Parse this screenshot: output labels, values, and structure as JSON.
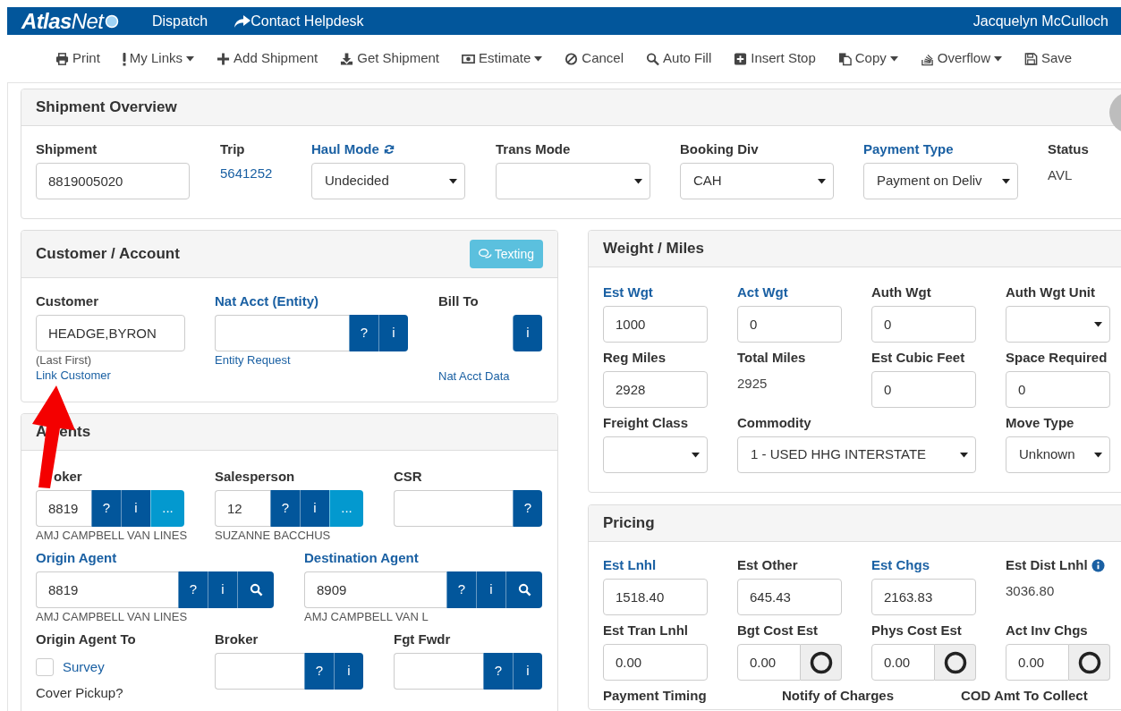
{
  "header": {
    "logo": [
      "Atlas",
      "Net"
    ],
    "nav": [
      {
        "label": "Dispatch"
      },
      {
        "label": "Contact Helpdesk"
      }
    ],
    "user": "Jacquelyn McCulloch"
  },
  "toolbar": [
    {
      "label": "Print",
      "dropdown": false
    },
    {
      "label": "My Links",
      "dropdown": true
    },
    {
      "label": "Add Shipment",
      "dropdown": false
    },
    {
      "label": "Get Shipment",
      "dropdown": false
    },
    {
      "label": "Estimate",
      "dropdown": true
    },
    {
      "label": "Cancel",
      "dropdown": false
    },
    {
      "label": "Auto Fill",
      "dropdown": false
    },
    {
      "label": "Insert Stop",
      "dropdown": false
    },
    {
      "label": "Copy",
      "dropdown": true
    },
    {
      "label": "Overflow",
      "dropdown": true
    },
    {
      "label": "Save",
      "dropdown": false
    }
  ],
  "panels": [
    {
      "title": "Shipment Overview",
      "rows": [
        [
          {
            "label": "Shipment",
            "label_link": false,
            "kind": "input",
            "value": "8819005020"
          },
          {
            "label": "Trip",
            "label_link": false,
            "kind": "link",
            "value": "5641252"
          },
          {
            "label": "Haul Mode",
            "label_link": true,
            "refresh": true,
            "kind": "select",
            "value": "Undecided"
          },
          {
            "label": "Trans Mode",
            "label_link": false,
            "kind": "select"
          },
          {
            "label": "Booking Div",
            "label_link": false,
            "kind": "select",
            "value": "CAH"
          },
          {
            "label": "Payment Type",
            "label_link": true,
            "kind": "select",
            "value": "Payment on Deliv"
          },
          {
            "label": "Status",
            "label_link": false,
            "kind": "text",
            "value": "AVL"
          }
        ]
      ]
    },
    {
      "title": "Customer / Account",
      "header_button": "Texting",
      "rows": [
        [
          {
            "label": "Customer",
            "label_link": false,
            "kind": "input",
            "value": "HEADGE,BYRON",
            "notes": [
              {
                "text": "(Last First)",
                "link": false
              },
              {
                "text": "Link Customer",
                "link": true
              }
            ]
          },
          {
            "label": "Nat Acct (Entity)",
            "label_link": true,
            "kind": "group",
            "buttons": [
              {
                "kind": "dark",
                "label": "?"
              },
              {
                "kind": "dark",
                "label": "i"
              }
            ],
            "notes": [
              {
                "text": "Entity Request",
                "link": true
              }
            ]
          },
          {
            "label": "Bill To",
            "label_link": false,
            "kind": "buttons",
            "buttons": [
              {
                "kind": "dark",
                "label": "i"
              }
            ],
            "notes": [
              {
                "text": "Nat Acct Data",
                "link": true
              }
            ]
          }
        ]
      ]
    },
    {
      "title_parts": [
        "A",
        "ents"
      ],
      "rows": [
        [
          {
            "label": "oker",
            "label_link": false,
            "kind": "group",
            "value": "8819",
            "buttons": [
              {
                "kind": "dark",
                "label": "?"
              },
              {
                "kind": "dark",
                "label": "i"
              },
              {
                "kind": "light",
                "label": "..."
              }
            ],
            "notes": [
              {
                "text": "AMJ CAMPBELL VAN LINES",
                "link": false
              }
            ]
          },
          {
            "label": "Salesperson",
            "label_link": false,
            "kind": "group",
            "value": "12",
            "buttons": [
              {
                "kind": "dark",
                "label": "?"
              },
              {
                "kind": "dark",
                "label": "i"
              },
              {
                "kind": "light",
                "label": "..."
              }
            ],
            "notes": [
              {
                "text": "SUZANNE BACCHUS",
                "link": false
              }
            ]
          },
          {
            "label": "CSR",
            "label_link": false,
            "kind": "group",
            "buttons": [
              {
                "kind": "dark",
                "label": "?"
              }
            ]
          }
        ],
        [
          {
            "label": "Origin Agent",
            "label_link": true,
            "kind": "group",
            "value": "8819",
            "buttons": [
              {
                "kind": "dark",
                "label": "?"
              },
              {
                "kind": "dark",
                "label": "i"
              },
              {
                "kind": "search"
              }
            ],
            "notes": [
              {
                "text": "AMJ CAMPBELL VAN LINES",
                "link": false
              }
            ]
          },
          {
            "label": "Destination Agent",
            "label_link": true,
            "kind": "group",
            "value": "8909",
            "buttons": [
              {
                "kind": "dark",
                "label": "?"
              },
              {
                "kind": "dark",
                "label": "i"
              },
              {
                "kind": "search"
              }
            ],
            "notes": [
              {
                "text": "AMJ CAMPBELL VAN L",
                "link": false
              }
            ]
          }
        ],
        [
          {
            "label": "Origin Agent To",
            "label_link": false,
            "kind": "checkbox",
            "checkbox": {
              "label": "Survey",
              "checked": false
            },
            "notes": [
              {
                "text": "Cover Pickup?",
                "link": false
              }
            ]
          },
          {
            "label": "Broker",
            "label_link": false,
            "kind": "group",
            "buttons": [
              {
                "kind": "dark",
                "label": "?"
              },
              {
                "kind": "dark",
                "label": "i"
              }
            ]
          },
          {
            "label": "Fgt Fwdr",
            "label_link": false,
            "kind": "group",
            "buttons": [
              {
                "kind": "dark",
                "label": "?"
              },
              {
                "kind": "dark",
                "label": "i"
              }
            ]
          }
        ]
      ]
    },
    {
      "title": "Weight / Miles",
      "rows": [
        [
          {
            "label": "Est Wgt",
            "label_link": true,
            "kind": "input",
            "value": "1000"
          },
          {
            "label": "Act Wgt",
            "label_link": true,
            "kind": "input",
            "value": "0"
          },
          {
            "label": "Auth Wgt",
            "label_link": false,
            "kind": "input",
            "value": "0"
          },
          {
            "label": "Auth Wgt Unit",
            "label_link": false,
            "kind": "select"
          }
        ],
        [
          {
            "label": "Reg Miles",
            "label_link": false,
            "kind": "input",
            "value": "2928"
          },
          {
            "label": "Total Miles",
            "label_link": false,
            "kind": "text",
            "value": "2925"
          },
          {
            "label": "Est Cubic Feet",
            "label_link": false,
            "kind": "input",
            "value": "0"
          },
          {
            "label": "Space Required",
            "label_link": false,
            "kind": "input",
            "value": "0"
          }
        ],
        [
          {
            "label": "Freight Class",
            "label_link": false,
            "kind": "select"
          },
          {
            "label": "Commodity",
            "label_link": false,
            "kind": "select",
            "value": "1 - USED HHG INTERSTATE"
          },
          "",
          {
            "label": "Move Type",
            "label_link": false,
            "kind": "select",
            "value": "Unknown"
          }
        ]
      ]
    },
    {
      "title": "Pricing",
      "rows": [
        [
          {
            "label": "Est Lnhl",
            "label_link": true,
            "kind": "input",
            "value": "1518.40"
          },
          {
            "label": "Est Other",
            "label_link": false,
            "kind": "input",
            "value": "645.43"
          },
          {
            "label": "Est Chgs",
            "label_link": true,
            "kind": "input",
            "value": "2163.83"
          },
          {
            "label": "Est Dist Lnhl",
            "label_link": false,
            "info": true,
            "kind": "text",
            "value": "3036.80"
          }
        ],
        [
          {
            "label": "Est Tran Lnhl",
            "label_link": false,
            "kind": "input",
            "value": "0.00"
          },
          {
            "label": "Bgt Cost Est",
            "label_link": false,
            "kind": "input_circle",
            "value": "0.00"
          },
          {
            "label": "Phys Cost Est",
            "label_link": false,
            "kind": "input_circle",
            "value": "0.00"
          },
          {
            "label": "Act Inv Chgs",
            "label_link": false,
            "kind": "input_circle",
            "value": "0.00"
          }
        ]
      ],
      "footer_labels": [
        "Payment Timing",
        "Notify of Charges",
        "COD Amt To Collect"
      ]
    }
  ]
}
